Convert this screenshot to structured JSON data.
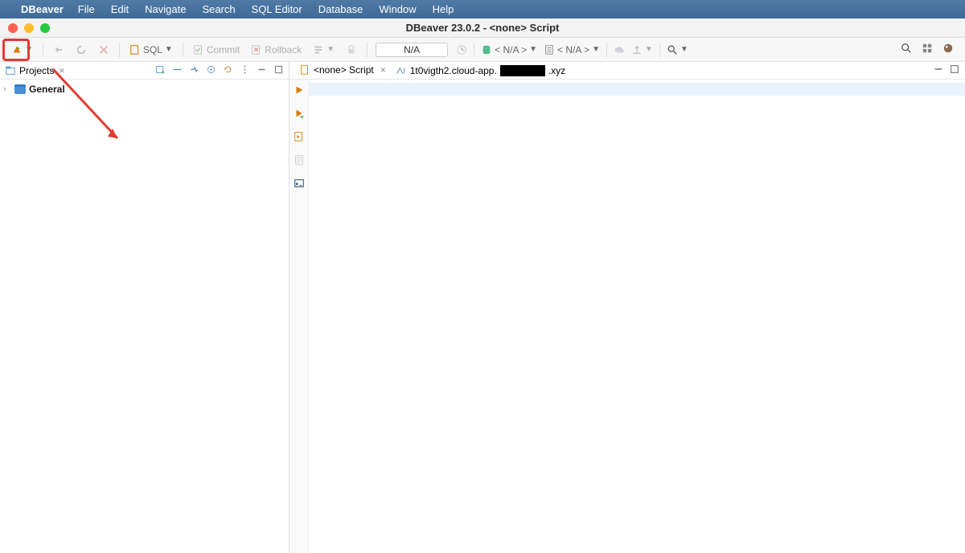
{
  "menubar": {
    "app": "DBeaver",
    "items": [
      "File",
      "Edit",
      "Navigate",
      "Search",
      "SQL Editor",
      "Database",
      "Window",
      "Help"
    ]
  },
  "window": {
    "title": "DBeaver 23.0.2 - <none> Script"
  },
  "toolbar": {
    "sql_label": "SQL",
    "commit_label": "Commit",
    "rollback_label": "Rollback",
    "na_label": "N/A",
    "na_dropdown_1": "< N/A >",
    "na_dropdown_2": "< N/A >"
  },
  "sidebar": {
    "panel_title": "Projects",
    "tree": {
      "root_label": "General"
    }
  },
  "editor": {
    "tab1_label": "<none> Script",
    "tab2_prefix": "1t0vigth2.cloud-app.",
    "tab2_suffix": ".xyz"
  }
}
